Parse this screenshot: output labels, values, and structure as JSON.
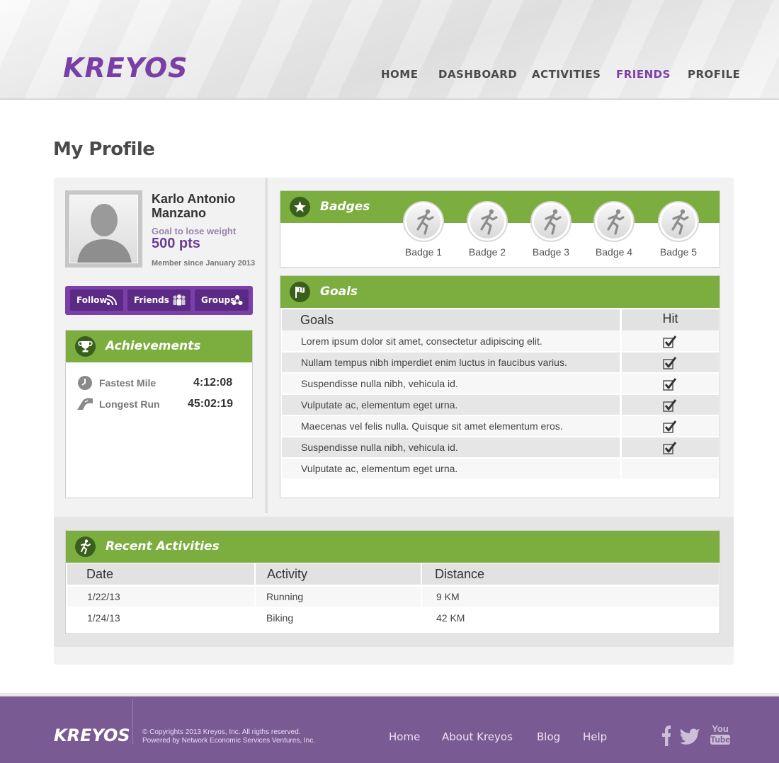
{
  "brand": {
    "logo_text": "KREYOS",
    "accent": "#7b3fa8",
    "green": "#7cae3f"
  },
  "nav": {
    "items": [
      {
        "label": "HOME",
        "active": false
      },
      {
        "label": "DASHBOARD",
        "active": false
      },
      {
        "label": "ACTIVITIES",
        "active": false
      },
      {
        "label": "FRIENDS",
        "active": true
      },
      {
        "label": "PROFILE",
        "active": false
      }
    ]
  },
  "page": {
    "title": "My Profile"
  },
  "profile": {
    "name": "Karlo Antonio Manzano",
    "goal": "Goal to lose weight",
    "points": "500 pts",
    "member_since": "Member since January 2013",
    "actions": [
      {
        "label": "Follow",
        "icon": "rss-icon"
      },
      {
        "label": "Friends",
        "icon": "friends-icon"
      },
      {
        "label": "Groups",
        "icon": "groups-icon"
      }
    ]
  },
  "achievements": {
    "title": "Achievements",
    "items": [
      {
        "label": "Fastest Mile",
        "value": "4:12:08",
        "icon": "clock-icon"
      },
      {
        "label": "Longest Run",
        "value": "45:02:19",
        "icon": "road-icon"
      }
    ]
  },
  "badges": {
    "title": "Badges",
    "items": [
      {
        "label": "Badge 1"
      },
      {
        "label": "Badge 2"
      },
      {
        "label": "Badge 3"
      },
      {
        "label": "Badge 4"
      },
      {
        "label": "Badge 5"
      }
    ]
  },
  "goals": {
    "title": "Goals",
    "columns": [
      "Goals",
      "Hit"
    ],
    "rows": [
      {
        "text": "Lorem ipsum dolor sit amet, consectetur adipiscing elit.",
        "hit": true
      },
      {
        "text": "Nullam tempus nibh imperdiet enim luctus in faucibus varius.",
        "hit": true
      },
      {
        "text": "Suspendisse nulla nibh, vehicula id.",
        "hit": true
      },
      {
        "text": "Vulputate ac, elementum eget urna.",
        "hit": true
      },
      {
        "text": "Maecenas vel felis nulla. Quisque sit amet elementum eros.",
        "hit": true
      },
      {
        "text": "Suspendisse nulla nibh, vehicula id.",
        "hit": true
      },
      {
        "text": "Vulputate ac, elementum eget urna.",
        "hit": false
      }
    ]
  },
  "recent_activities": {
    "title": "Recent Activities",
    "columns": [
      "Date",
      "Activity",
      "Distance"
    ],
    "rows": [
      {
        "date": "1/22/13",
        "activity": "Running",
        "distance": "9 KM"
      },
      {
        "date": "1/24/13",
        "activity": "Biking",
        "distance": "42 KM"
      }
    ]
  },
  "footer": {
    "logo_text": "KREYOS",
    "copyright": "© Copyrights 2013 Kreyos, Inc. All rigths reserved.",
    "powered_by": "Powered by Network  Economic Services Ventures, Inc.",
    "links": [
      "Home",
      "About Kreyos",
      "Blog",
      "Help"
    ],
    "social": [
      "facebook-icon",
      "twitter-icon",
      "youtube-icon"
    ],
    "youtube_text": [
      "You",
      "Tube"
    ]
  }
}
